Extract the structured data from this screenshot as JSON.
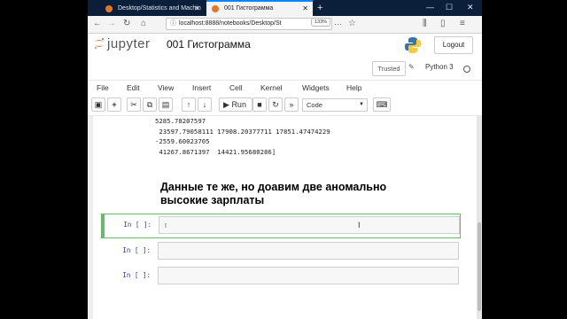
{
  "browser": {
    "tabs": [
      {
        "label": "Desktop/Statistics and Machin",
        "active": false
      },
      {
        "label": "001 Гистограмма",
        "active": true
      }
    ],
    "url": "localhost:8888/notebooks/Desktop/St",
    "zoom": "133%"
  },
  "jupyter": {
    "logo_text": "jupyter",
    "notebook_title": "001 Гистограмма",
    "logout_label": "Logout",
    "trusted_label": "Trusted",
    "kernel_name": "Python 3"
  },
  "menu": [
    "File",
    "Edit",
    "View",
    "Insert",
    "Cell",
    "Kernel",
    "Widgets",
    "Help"
  ],
  "toolbar": {
    "run_label": "Run",
    "cell_type": "Code"
  },
  "output_lines": [
    "5285.78207597",
    " 23597.79058111 17908.20377711 17851.47474229",
    "-2559.60023705",
    " 41267.8671397  14421.95680286]"
  ],
  "markdown_heading": [
    "Данные те же, но доавим две аномально",
    "высокие зарплаты"
  ],
  "cells": [
    {
      "prompt": "In [ ]:",
      "selected": true
    },
    {
      "prompt": "In [ ]:",
      "selected": false
    },
    {
      "prompt": "In [ ]:",
      "selected": false
    }
  ],
  "colors": {
    "tabbar": "#0b1f3a",
    "selected_cell": "#66bb6a",
    "prompt": "#303f9f",
    "jupyter_orange": "#f37726"
  }
}
